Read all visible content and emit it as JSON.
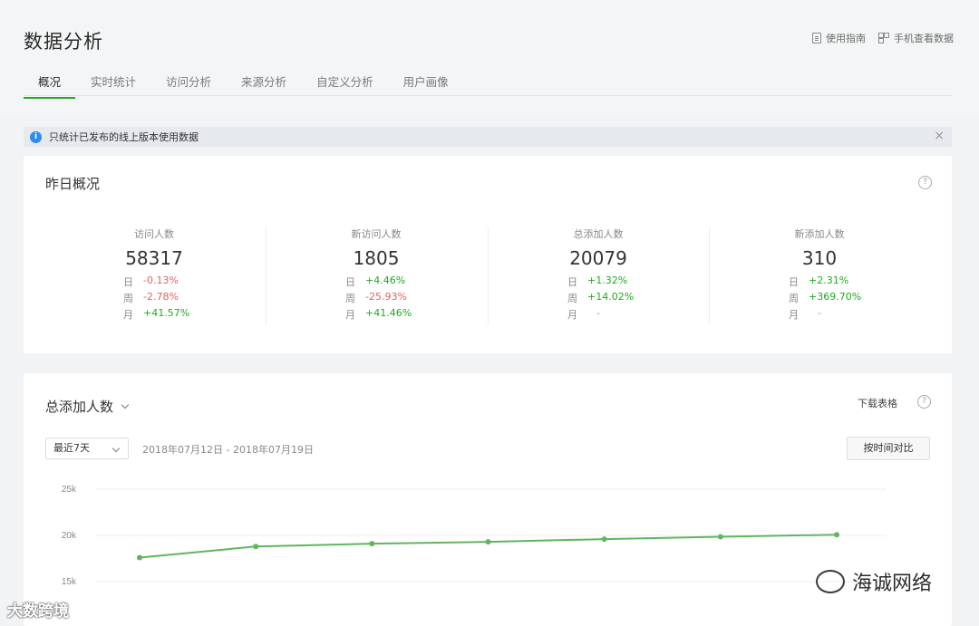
{
  "header": {
    "title": "数据分析",
    "links": [
      "使用指南",
      "手机查看数据"
    ],
    "tabs": [
      "概况",
      "实时统计",
      "访问分析",
      "来源分析",
      "自定义分析",
      "用户画像"
    ]
  },
  "notice": {
    "text": "只统计已发布的线上版本使用数据",
    "info_icon": "i",
    "close": "×"
  },
  "overview": {
    "title": "昨日概况",
    "help": "?",
    "stats": [
      {
        "label": "访问人数",
        "value": "58317",
        "rows": [
          {
            "k": "日",
            "v": "-0.13%",
            "t": "down"
          },
          {
            "k": "周",
            "v": "-2.78%",
            "t": "down"
          },
          {
            "k": "月",
            "v": "+41.57%",
            "t": "up"
          }
        ]
      },
      {
        "label": "新访问人数",
        "value": "1805",
        "rows": [
          {
            "k": "日",
            "v": "+4.46%",
            "t": "up"
          },
          {
            "k": "周",
            "v": "-25.93%",
            "t": "down"
          },
          {
            "k": "月",
            "v": "+41.46%",
            "t": "up"
          }
        ]
      },
      {
        "label": "总添加人数",
        "value": "20079",
        "rows": [
          {
            "k": "日",
            "v": "+1.32%",
            "t": "up"
          },
          {
            "k": "周",
            "v": "+14.02%",
            "t": "up"
          },
          {
            "k": "月",
            "v": "-",
            "t": "none"
          }
        ]
      },
      {
        "label": "新添加人数",
        "value": "310",
        "rows": [
          {
            "k": "日",
            "v": "+2.31%",
            "t": "up"
          },
          {
            "k": "周",
            "v": "+369.70%",
            "t": "up"
          },
          {
            "k": "月",
            "v": "-",
            "t": "none"
          }
        ]
      }
    ]
  },
  "trend": {
    "title": "总添加人数",
    "download": "下载表格",
    "help": "?",
    "range_select": "最近7天",
    "date_range": "2018年07月12日 - 2018年07月19日",
    "compare_button": "按时间对比"
  },
  "chart_data": {
    "type": "line",
    "y_ticks": [
      "25k",
      "20k",
      "15k"
    ],
    "ylim": [
      15000,
      25000
    ],
    "x": [
      1,
      2,
      3,
      4,
      5,
      6,
      7
    ],
    "series": [
      {
        "values": [
          17600,
          18800,
          19100,
          19300,
          19600,
          19850,
          20079
        ]
      }
    ],
    "color": "#60b55d",
    "grid": true
  },
  "watermarks": {
    "left": "大数跨境",
    "right": "海诚网络"
  }
}
